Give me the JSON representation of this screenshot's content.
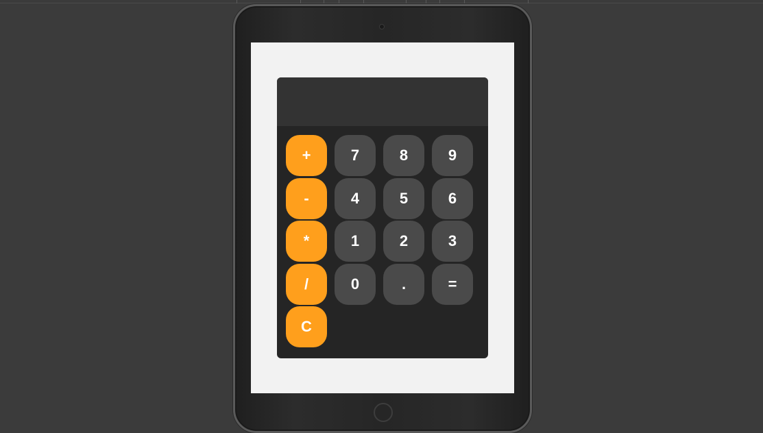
{
  "calculator": {
    "display_value": "",
    "operators": [
      {
        "label": "+",
        "name": "add-button"
      },
      {
        "label": "-",
        "name": "subtract-button"
      },
      {
        "label": "*",
        "name": "multiply-button"
      },
      {
        "label": "/",
        "name": "divide-button"
      },
      {
        "label": "C",
        "name": "clear-button"
      }
    ],
    "rows": [
      [
        {
          "label": "7",
          "name": "digit-7-button"
        },
        {
          "label": "8",
          "name": "digit-8-button"
        },
        {
          "label": "9",
          "name": "digit-9-button"
        }
      ],
      [
        {
          "label": "4",
          "name": "digit-4-button"
        },
        {
          "label": "5",
          "name": "digit-5-button"
        },
        {
          "label": "6",
          "name": "digit-6-button"
        }
      ],
      [
        {
          "label": "1",
          "name": "digit-1-button"
        },
        {
          "label": "2",
          "name": "digit-2-button"
        },
        {
          "label": "3",
          "name": "digit-3-button"
        }
      ],
      [
        {
          "label": "0",
          "name": "digit-0-button"
        },
        {
          "label": ".",
          "name": "decimal-button"
        },
        {
          "label": "=",
          "name": "equals-button"
        }
      ]
    ]
  },
  "colors": {
    "operator": "#ff9f1c",
    "number": "#4a4a4a",
    "display_bg": "#333333",
    "keypad_bg": "#252525",
    "screen_bg": "#f2f2f2",
    "page_bg": "#3b3b3b"
  }
}
